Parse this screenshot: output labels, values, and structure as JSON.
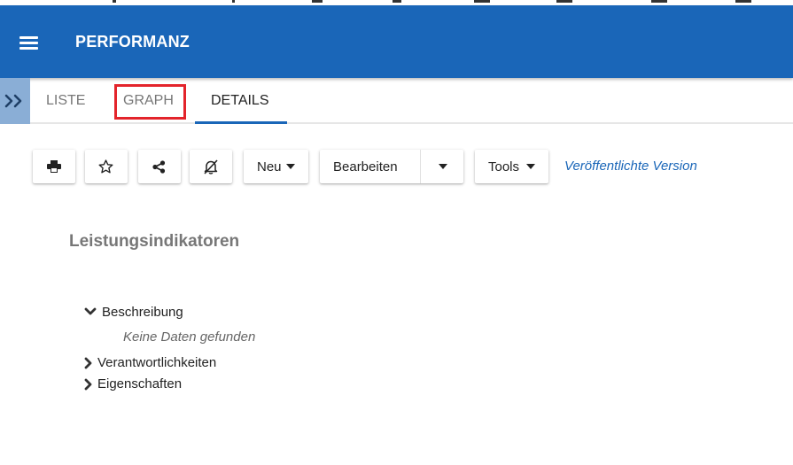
{
  "app": {
    "title": "PERFORMANZ"
  },
  "tabs": [
    {
      "label": "LISTE",
      "active": false
    },
    {
      "label": "GRAPH",
      "active": false,
      "highlighted": true
    },
    {
      "label": "DETAILS",
      "active": true
    }
  ],
  "toolbar": {
    "icons": [
      "printer-icon",
      "star-icon",
      "share-icon",
      "bell-slash-icon"
    ],
    "new_label": "Neu",
    "edit_label": "Bearbeiten",
    "tools_label": "Tools",
    "version_link": "Veröffentlichte Version"
  },
  "section": {
    "title": "Leistungsindikatoren"
  },
  "tree": [
    {
      "label": "Beschreibung",
      "expanded": true,
      "empty_text": "Keine Daten gefunden"
    },
    {
      "label": "Verantwortlichkeiten",
      "expanded": false
    },
    {
      "label": "Eigenschaften",
      "expanded": false
    }
  ],
  "colors": {
    "primary": "#1a66b8",
    "expander": "#8aaed6",
    "highlight": "#e3242b"
  }
}
